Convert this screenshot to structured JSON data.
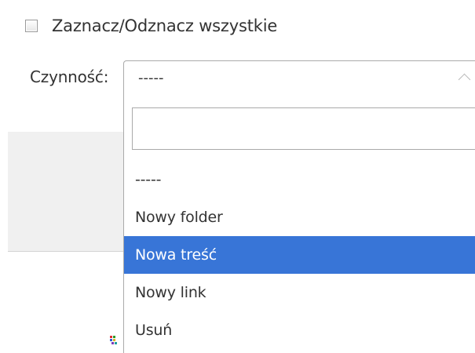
{
  "select_all": {
    "label": "Zaznacz/Odznacz wszystkie",
    "checked": false
  },
  "action": {
    "label": "Czynność:",
    "selected_value": "-----",
    "search_value": "",
    "options": [
      {
        "label": "-----",
        "highlighted": false
      },
      {
        "label": "Nowy folder",
        "highlighted": false
      },
      {
        "label": "Nowa treść",
        "highlighted": true
      },
      {
        "label": "Nowy link",
        "highlighted": false
      },
      {
        "label": "Usuń",
        "highlighted": false
      }
    ]
  },
  "colors": {
    "highlight": "#3875d7",
    "border": "#aaaaaa",
    "panel_bg": "#f0f0f0",
    "text": "#333333"
  },
  "icons": {
    "select_arrow": "chevron-up-icon",
    "grid": "color-grid-icon"
  }
}
